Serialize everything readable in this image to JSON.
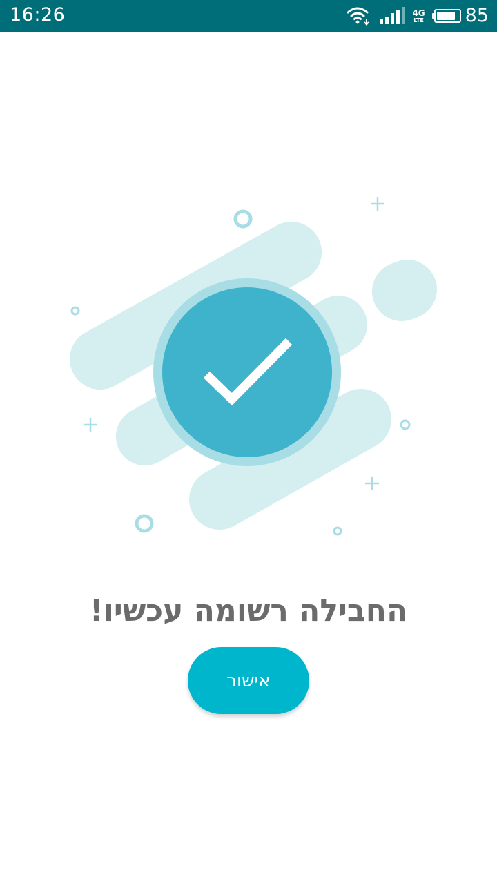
{
  "status_bar": {
    "time": "16:26",
    "network_generation": "4G",
    "network_technology": "LTE",
    "battery_level": "85",
    "battery_fraction": 0.85,
    "background_color": "#006e79",
    "icons": [
      "wifi-icon",
      "cellular-signal-icon",
      "battery-icon"
    ]
  },
  "illustration": {
    "icon": "check-icon",
    "circle_color": "#3fb3cc",
    "halo_color": "#a9dde6",
    "shape_color": "#d5eef0",
    "accent_color": "#a9dde6"
  },
  "message": {
    "title": "החבילה רשומה עכשיו!"
  },
  "actions": {
    "confirm_label": "אישור",
    "confirm_color": "#00b6cd"
  }
}
